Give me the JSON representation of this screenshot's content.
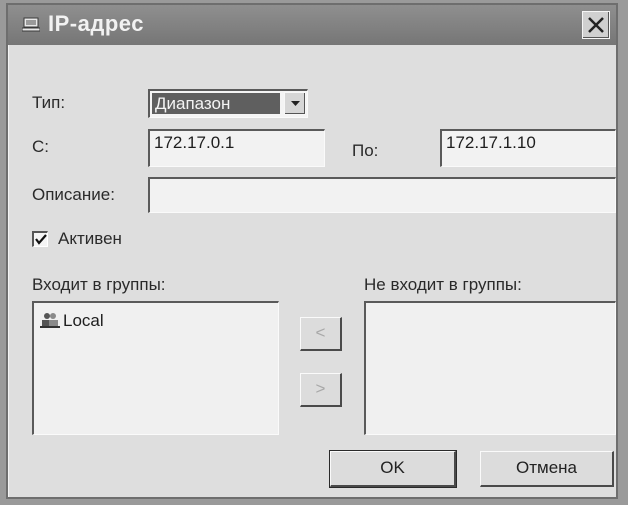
{
  "window": {
    "title": "IP-адрес",
    "icon": "computer-icon"
  },
  "form": {
    "type_label": "Тип:",
    "type_value": "Диапазон",
    "from_label": "С:",
    "from_value": "172.17.0.1",
    "to_label": "По:",
    "to_value": "172.17.1.10",
    "description_label": "Описание:",
    "description_value": "",
    "active_label": "Активен",
    "active_checked": true
  },
  "groups": {
    "member_label": "Входит в группы:",
    "member_items": [
      {
        "label": "Local",
        "icon": "group-icon"
      }
    ],
    "nonmember_label": "Не входит в группы:",
    "nonmember_items": [],
    "move_left_label": "<",
    "move_right_label": ">"
  },
  "buttons": {
    "ok": "OK",
    "cancel": "Отмена"
  }
}
